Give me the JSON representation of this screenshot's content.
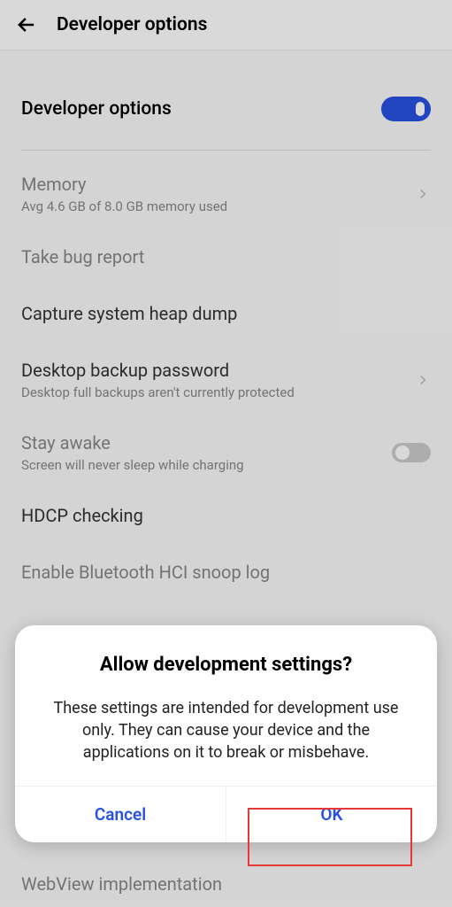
{
  "header": {
    "title": "Developer options"
  },
  "mainToggle": {
    "label": "Developer options",
    "state": "on"
  },
  "settings": {
    "memory": {
      "title": "Memory",
      "subtitle": "Avg 4.6 GB of 8.0 GB memory used"
    },
    "bugReport": {
      "title": "Take bug report"
    },
    "heapDump": {
      "title": "Capture system heap dump"
    },
    "backupPassword": {
      "title": "Desktop backup password",
      "subtitle": "Desktop full backups aren't currently protected"
    },
    "stayAwake": {
      "title": "Stay awake",
      "subtitle": "Screen will never sleep while charging"
    },
    "hdcp": {
      "title": "HDCP checking"
    },
    "bluetoothHci": {
      "title": "Enable Bluetooth HCI snoop log"
    },
    "webview": {
      "title": "WebView implementation"
    }
  },
  "dialog": {
    "title": "Allow development settings?",
    "body": "These settings are intended for development use only. They can cause your device and the applications on it to break or misbehave.",
    "cancel": "Cancel",
    "ok": "OK"
  }
}
